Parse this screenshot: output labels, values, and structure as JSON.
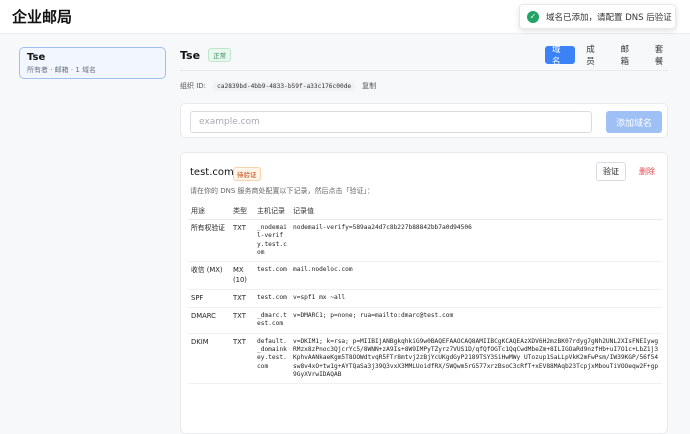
{
  "app": {
    "title": "企业邮局"
  },
  "toast": {
    "text": "域名已添加，请配置 DNS 后验证"
  },
  "sidebar": {
    "org_name": "Tse",
    "org_meta": "所有者 · 邮箱 · 1 域名"
  },
  "org": {
    "name": "Tse",
    "status": "正常",
    "id_label": "组织 ID:",
    "id_value": "ca2839bd-4bb9-4833-b59f-a33c176c00de",
    "copy_label": "复制"
  },
  "tabs": [
    {
      "label": "域名",
      "active": true
    },
    {
      "label": "成员",
      "active": false
    },
    {
      "label": "邮箱",
      "active": false
    },
    {
      "label": "套餐",
      "active": false
    }
  ],
  "add_domain": {
    "placeholder": "example.com",
    "button_label": "添加域名"
  },
  "domain": {
    "name": "test.com",
    "status": "待验证",
    "verify_label": "验证",
    "delete_label": "删除",
    "instruction": "请在你的 DNS 服务商处配置以下记录，然后点击「验证」：",
    "columns": [
      "用途",
      "类型",
      "主机记录",
      "记录值"
    ],
    "records": [
      {
        "purpose": "所有权验证",
        "type": "TXT",
        "host": "_nodemail-verify.test.com",
        "value": "nodemail-verify=589aa24d7c8b227b88842bb7a0d94506"
      },
      {
        "purpose": "收信 (MX)",
        "type": "MX (10)",
        "host": "test.com",
        "value": "mail.nodeloc.com"
      },
      {
        "purpose": "SPF",
        "type": "TXT",
        "host": "test.com",
        "value": "v=spf1 mx ~all"
      },
      {
        "purpose": "DMARC",
        "type": "TXT",
        "host": "_dmarc.test.com",
        "value": "v=DMARC1; p=none; rua=mailto:dmarc@test.com"
      },
      {
        "purpose": "DKIM",
        "type": "TXT",
        "host": "default._domainkey.test.com",
        "value": "v=DKIM1; k=rsa; p=MIIBIjANBgkqhkiG9w0BAQEFAAOCAQ8AMIIBCgKCAQEAzXDV6H2mzBK07rdyg7gNh2UNL2XIsFNEIywgRMzx8zPnoc3QjcrYc5/8WNN+zA9Is+8W9IMPyTZyrz7VUS1D/qfQfOGTc1QqCwdMbeZm+8ILIGOaRd9nzfHb+uI7O1c+LbZ1j3KphvAANkaeKgm5T8OOWdtvqR5FTr8mtvj2zBjYcUKgdGyP2189TSY3SiHwMWy UTozup1SaLLpVkK2mFwPsm/IW39KGP/56f54sw8v4xO+tw1g+AYTQaSa3j39Q3vxX3MMLUoidfRX/5WQwm5rG577xrzBsoC3cRfT+xEV88MAqb23TcpjxMbouTiVOOeqw2F+gp9GyXVrwIDAQAB"
      }
    ]
  }
}
